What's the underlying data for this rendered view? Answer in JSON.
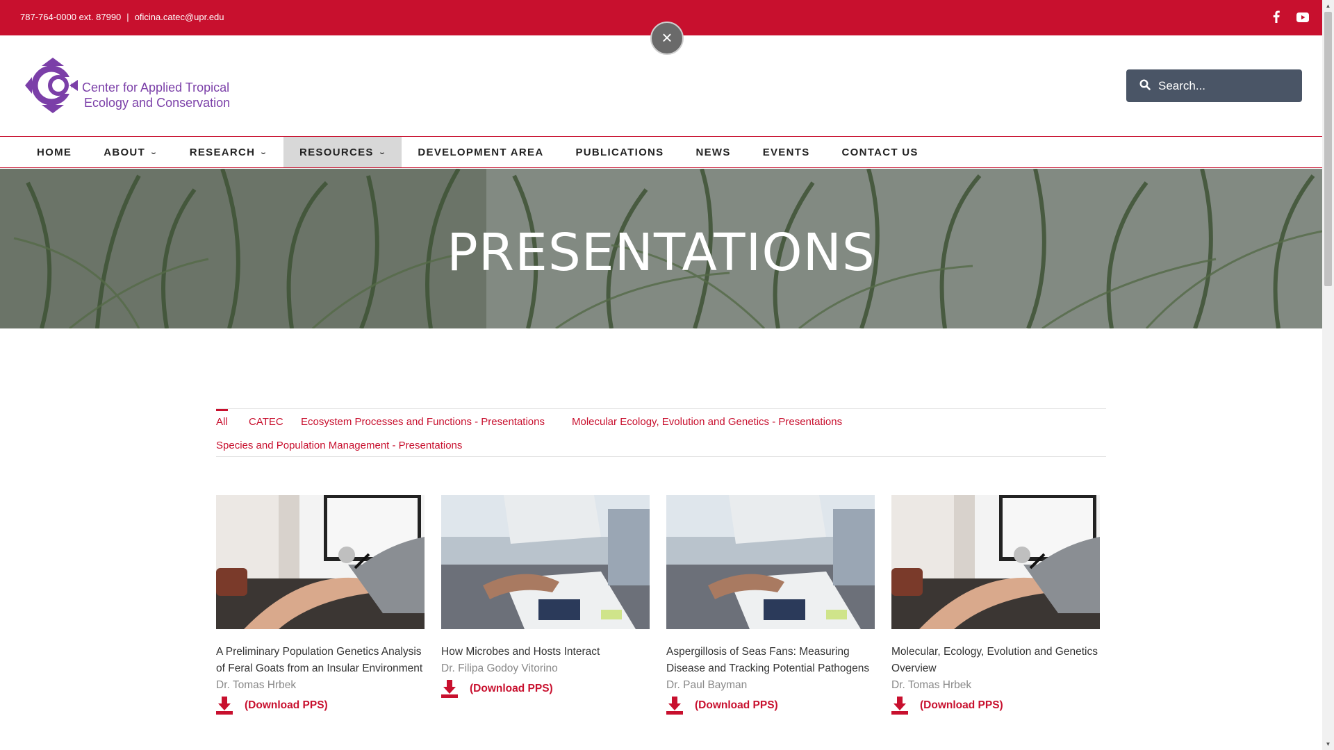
{
  "topbar": {
    "phone": "787-764-0000 ext. 87990",
    "separator": "|",
    "email": "oficina.catec@upr.edu",
    "bg_color": "#c8102e",
    "social": [
      "facebook-icon",
      "youtube-icon"
    ]
  },
  "close_button": {
    "label": "×"
  },
  "header": {
    "logo_line1": "Center for Applied Tropical",
    "logo_line2": "Ecology and Conservation",
    "logo_color": "#7b3fa8",
    "search_placeholder": "Search..."
  },
  "nav": {
    "items": [
      {
        "label": "HOME",
        "dropdown": false,
        "active": false
      },
      {
        "label": "ABOUT",
        "dropdown": true,
        "active": false
      },
      {
        "label": "RESEARCH",
        "dropdown": true,
        "active": false
      },
      {
        "label": "RESOURCES",
        "dropdown": true,
        "active": true
      },
      {
        "label": "DEVELOPMENT AREA",
        "dropdown": false,
        "active": false
      },
      {
        "label": "PUBLICATIONS",
        "dropdown": false,
        "active": false
      },
      {
        "label": "NEWS",
        "dropdown": false,
        "active": false
      },
      {
        "label": "EVENTS",
        "dropdown": false,
        "active": false
      },
      {
        "label": "CONTACT US",
        "dropdown": false,
        "active": false
      }
    ],
    "chevron": "⌄"
  },
  "hero": {
    "title": "PRESENTATIONS"
  },
  "filters": {
    "items": [
      "All",
      "CATEC",
      "Ecosystem Processes and Functions - Presentations",
      "Molecular Ecology, Evolution and Genetics - Presentations",
      "Species and Population Management - Presentations"
    ],
    "active": "All"
  },
  "cards": [
    {
      "title_line1": "A Preliminary Population Genetics Analysis",
      "title_line2": "of Feral Goats from an Insular Environment",
      "author": "Dr. Tomas Hrbek",
      "download": "(Download PPS)",
      "image": "person-drawing-at-desk"
    },
    {
      "title_line1": "How Microbes and Hosts Interact",
      "title_line2": "",
      "author": "Dr. Filipa Godoy Vitorino",
      "download": "(Download PPS)",
      "image": "meeting-with-charts"
    },
    {
      "title_line1": "Aspergillosis of Seas Fans: Measuring",
      "title_line2": "Disease and Tracking Potential Pathogens",
      "author": "Dr. Paul Bayman",
      "download": "(Download PPS)",
      "image": "meeting-with-charts"
    },
    {
      "title_line1": "Molecular, Ecology, Evolution and Genetics",
      "title_line2": "Overview",
      "author": "Dr. Tomas Hrbek",
      "download": "(Download PPS)",
      "image": "person-drawing-at-desk"
    }
  ]
}
